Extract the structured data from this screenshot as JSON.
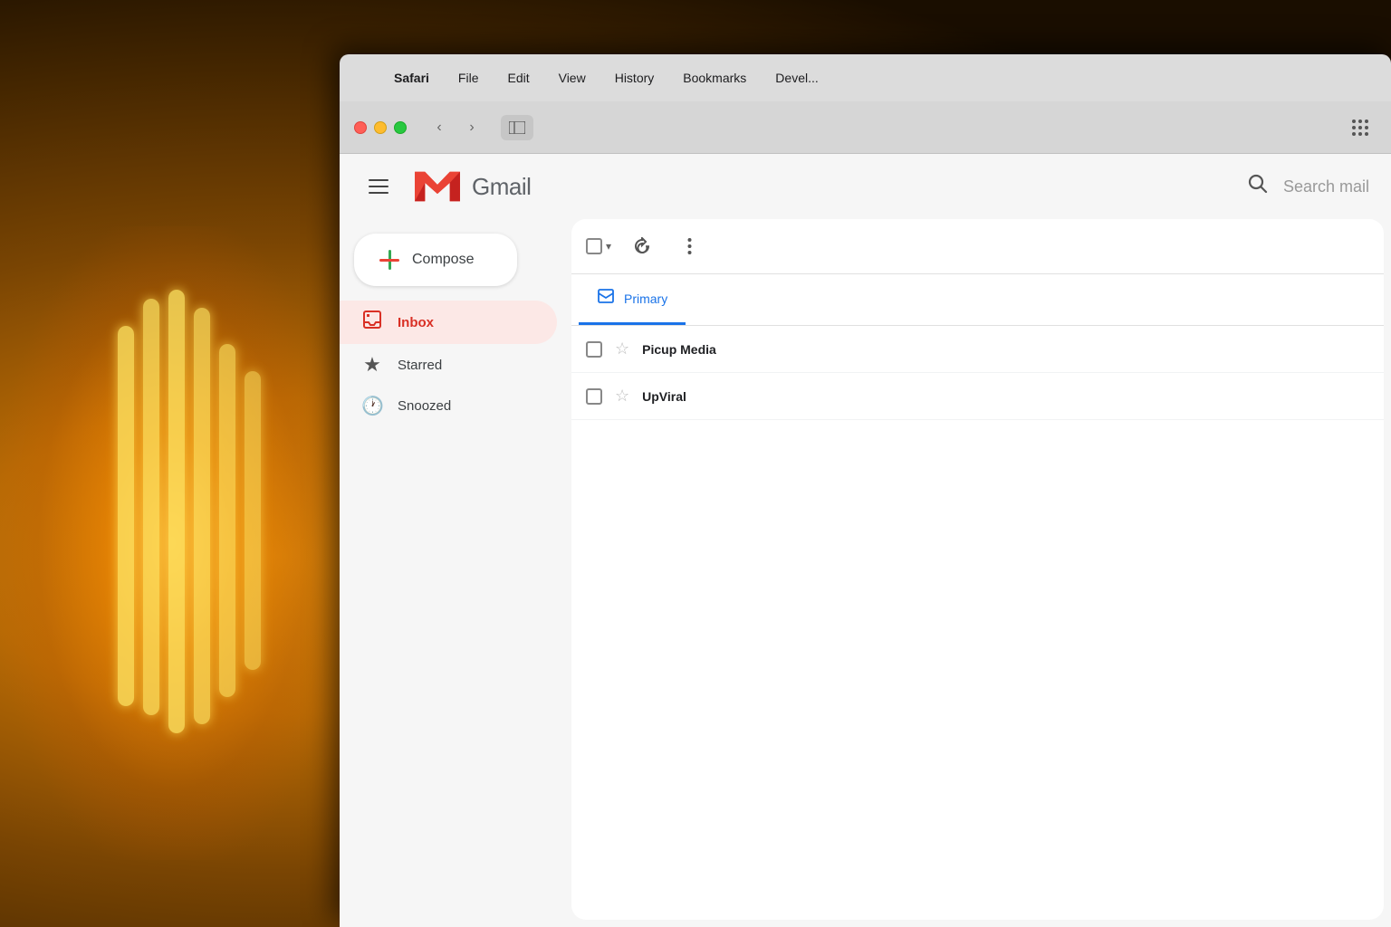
{
  "background": {
    "description": "Dark warm photography background with glowing light bulbs"
  },
  "mac_menubar": {
    "apple_symbol": "",
    "items": [
      {
        "label": "Safari",
        "bold": true
      },
      {
        "label": "File"
      },
      {
        "label": "Edit"
      },
      {
        "label": "View"
      },
      {
        "label": "History"
      },
      {
        "label": "Bookmarks"
      },
      {
        "label": "Devel..."
      }
    ]
  },
  "browser_chrome": {
    "back_button": "‹",
    "forward_button": "›",
    "sidebar_icon": "⊡"
  },
  "gmail": {
    "menu_icon": "☰",
    "logo_text": "Gmail",
    "search_placeholder": "Search mail",
    "compose_label": "Compose",
    "nav_items": [
      {
        "id": "inbox",
        "label": "Inbox",
        "icon": "🔖",
        "active": true
      },
      {
        "id": "starred",
        "label": "Starred",
        "icon": "★",
        "active": false
      },
      {
        "id": "snoozed",
        "label": "Snoozed",
        "icon": "🕐",
        "active": false
      }
    ],
    "toolbar": {
      "select_all_label": "Select all",
      "refresh_label": "Refresh",
      "more_label": "More options"
    },
    "category_tabs": [
      {
        "id": "primary",
        "label": "Primary",
        "active": true
      }
    ],
    "emails": [
      {
        "sender": "Picup Media",
        "starred": false
      },
      {
        "sender": "UpViral",
        "starred": false
      }
    ]
  }
}
